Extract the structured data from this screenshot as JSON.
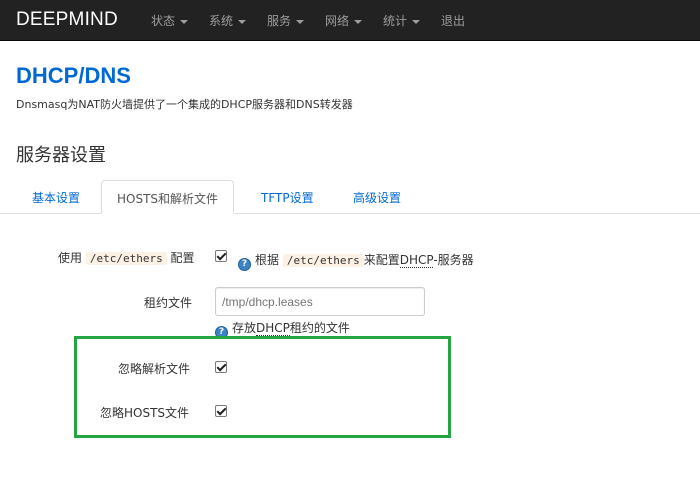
{
  "navbar": {
    "brand": "DEEPMIND",
    "items": [
      {
        "label": "状态",
        "dropdown": true
      },
      {
        "label": "系统",
        "dropdown": true
      },
      {
        "label": "服务",
        "dropdown": true
      },
      {
        "label": "网络",
        "dropdown": true
      },
      {
        "label": "统计",
        "dropdown": true
      },
      {
        "label": "退出",
        "dropdown": false
      }
    ]
  },
  "page": {
    "title": "DHCP/DNS",
    "description": "Dnsmasq为NAT防火墙提供了一个集成的DHCP服务器和DNS转发器",
    "section_title": "服务器设置"
  },
  "tabs": [
    {
      "label": "基本设置",
      "active": false
    },
    {
      "label": "HOSTS和解析文件",
      "active": true
    },
    {
      "label": "TFTP设置",
      "active": false
    },
    {
      "label": "高级设置",
      "active": false
    }
  ],
  "form": {
    "ethers": {
      "label_prefix": "使用",
      "label_code": "/etc/ethers",
      "label_suffix": "配置",
      "checked": true,
      "help_prefix": "根据",
      "help_code": "/etc/ethers",
      "help_middle": "来配置",
      "help_abbr": "DHCP",
      "help_suffix": "-服务器"
    },
    "leasefile": {
      "label": "租约文件",
      "placeholder": "/tmp/dhcp.leases",
      "help_prefix": "存放",
      "help_abbr": "DHCP",
      "help_suffix": "租约的文件"
    },
    "noresolv": {
      "label": "忽略解析文件",
      "checked": true
    },
    "nohosts": {
      "label": "忽略HOSTS文件",
      "checked": true
    }
  },
  "colors": {
    "navbar_bg": "#222222",
    "title_blue": "#0069d6",
    "highlight_green": "#22a542",
    "help_icon_blue": "#3a83c6"
  }
}
